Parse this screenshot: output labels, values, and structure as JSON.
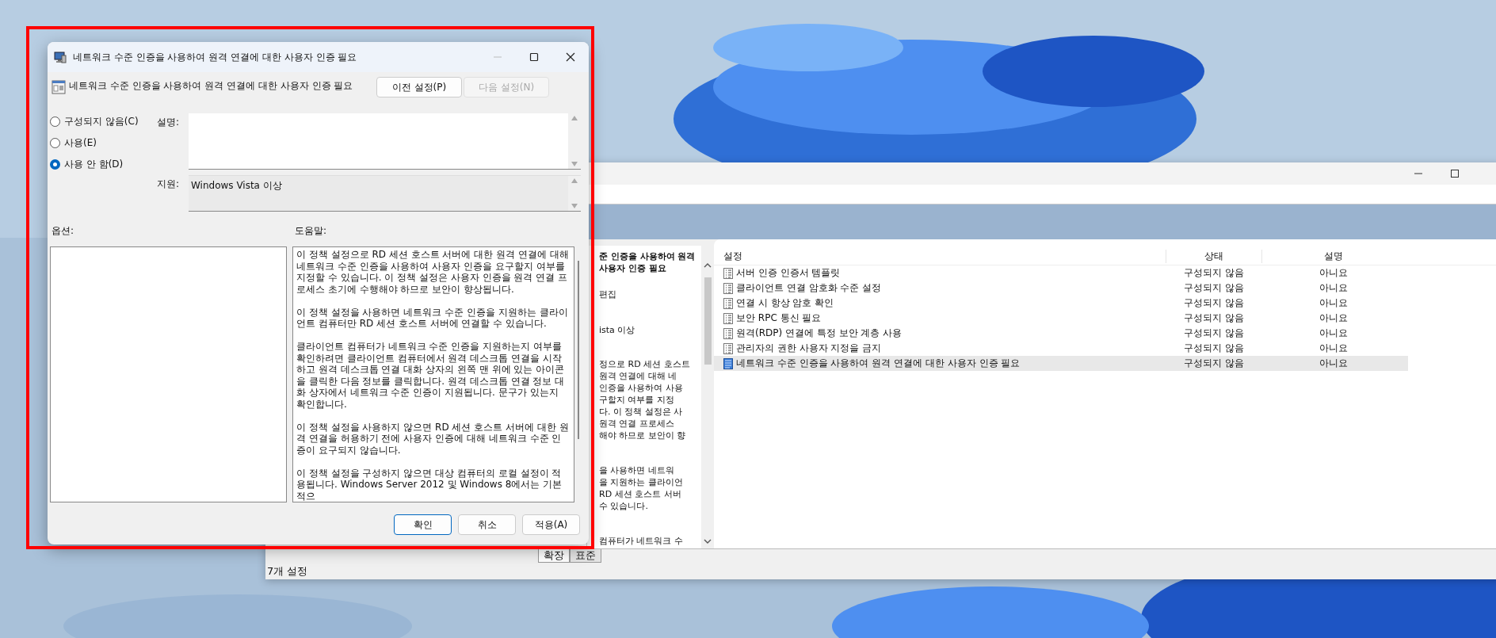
{
  "dialog": {
    "title": "네트워크 수준 인증을 사용하여 원격 연결에 대한 사용자 인증 필요",
    "heading": "네트워크 수준 인증을 사용하여 원격 연결에 대한 사용자 인증 필요",
    "nav_buttons": [
      {
        "label": "이전 설정(P)",
        "disabled": false
      },
      {
        "label": "다음 설정(N)",
        "disabled": true
      }
    ],
    "options": [
      {
        "label": "구성되지 않음(C)",
        "selected": false
      },
      {
        "label": "사용(E)",
        "selected": false
      },
      {
        "label": "사용 안 함(D)",
        "selected": true
      }
    ],
    "comment_label": "설명:",
    "support_label": "지원:",
    "support_value": "Windows Vista 이상",
    "options_label": "옵션:",
    "help_label": "도움말:",
    "help": [
      "이 정책 설정으로 RD 세션 호스트 서버에 대한 원격 연결에 대해 네트워크 수준 인증을 사용하여 사용자 인증을 요구할지 여부를 지정할 수 있습니다. 이 정책 설정은 사용자 인증을 원격 연결 프로세스 초기에 수행해야 하므로 보안이 향상됩니다.",
      "이 정책 설정을 사용하면 네트워크 수준 인증을 지원하는 클라이언트 컴퓨터만 RD 세션 호스트 서버에 연결할 수 있습니다.",
      "클라이언트 컴퓨터가 네트워크 수준 인증을 지원하는지 여부를 확인하려면 클라이언트 컴퓨터에서 원격 데스크톱 연결을 시작하고 원격 데스크톱 연결 대화 상자의 왼쪽 맨 위에 있는 아이콘을 클릭한 다음 정보를 클릭합니다. 원격 데스크톱 연결 정보 대화 상자에서 네트워크 수준 인증이 지원됩니다. 문구가 있는지 확인합니다.",
      "이 정책 설정을 사용하지 않으면 RD 세션 호스트 서버에 대한 원격 연결을 허용하기 전에 사용자 인증에 대해 네트워크 수준 인증이 요구되지 않습니다.",
      "이 정책 설정을 구성하지 않으면 대상 컴퓨터의 로컬 설정이 적용됩니다. Windows Server 2012 및 Windows 8에서는 기본적으"
    ],
    "buttons": [
      {
        "label": "확인",
        "kind": "default"
      },
      {
        "label": "취소",
        "kind": "normal"
      },
      {
        "label": "적용(A)",
        "kind": "normal"
      }
    ]
  },
  "editor": {
    "pane_title": [
      "준 인증을 사용하여 원격",
      "사용자 인증 필요"
    ],
    "pane_edit": "편집",
    "pane_support": "ista 이상",
    "pane_text": [
      [
        "정으로 RD 세션 호스트",
        "원격 연결에 대해 네",
        "인증을 사용하여 사용",
        "구할지 여부를 지정",
        "다. 이 정책 설정은 사",
        "원격 연결 프로세스",
        "해야 하므로 보안이 향"
      ],
      [
        "을 사용하면 네트워",
        "을 지원하는 클라이언",
        "RD 세션 호스트 서버",
        "수 있습니다."
      ],
      [
        "컴퓨터가 네트워크 수"
      ]
    ],
    "columns": [
      "설정",
      "상태",
      "설명"
    ],
    "rows": [
      {
        "name": "서버 인증 인증서 템플릿",
        "state": "구성되지 않음",
        "comment": "아니요",
        "selected": false
      },
      {
        "name": "클라이언트 연결 암호화 수준 설정",
        "state": "구성되지 않음",
        "comment": "아니요",
        "selected": false
      },
      {
        "name": "연결 시 항상 암호 확인",
        "state": "구성되지 않음",
        "comment": "아니요",
        "selected": false
      },
      {
        "name": "보안 RPC 통신 필요",
        "state": "구성되지 않음",
        "comment": "아니요",
        "selected": false
      },
      {
        "name": "원격(RDP) 연결에 특정 보안 계층 사용",
        "state": "구성되지 않음",
        "comment": "아니요",
        "selected": false
      },
      {
        "name": "관리자의 권한 사용자 지정을 금지",
        "state": "구성되지 않음",
        "comment": "아니요",
        "selected": false
      },
      {
        "name": "네트워크 수준 인증을 사용하여 원격 연결에 대한 사용자 인증 필요",
        "state": "구성되지 않음",
        "comment": "아니요",
        "selected": true
      }
    ],
    "tabs": [
      {
        "label": "확장",
        "selected": true
      },
      {
        "label": "표준",
        "selected": false
      }
    ],
    "status": "7개 설정"
  }
}
